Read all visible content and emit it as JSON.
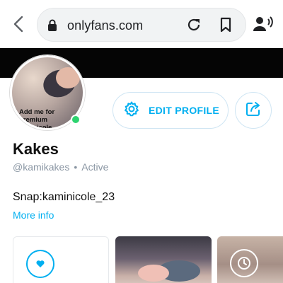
{
  "browser": {
    "url": "onlyfans.com",
    "icons": [
      "back-arrow-icon",
      "lock-icon",
      "reload-icon",
      "bookmark-icon",
      "account-audio-icon"
    ]
  },
  "profile": {
    "avatar_caption": "Add me for\npremium\n...minicole...",
    "name": "Kakes",
    "handle": "@kamikakes",
    "status": "Active",
    "bio": "Snap:kaminicole_23",
    "more_info": "More info"
  },
  "actions": {
    "edit_profile_label": "EDIT PROFILE",
    "edit_icon": "gear-icon",
    "share_icon": "share-icon"
  },
  "colors": {
    "accent": "#00aff0",
    "online": "#2dd36f",
    "muted": "#8a96a3"
  }
}
